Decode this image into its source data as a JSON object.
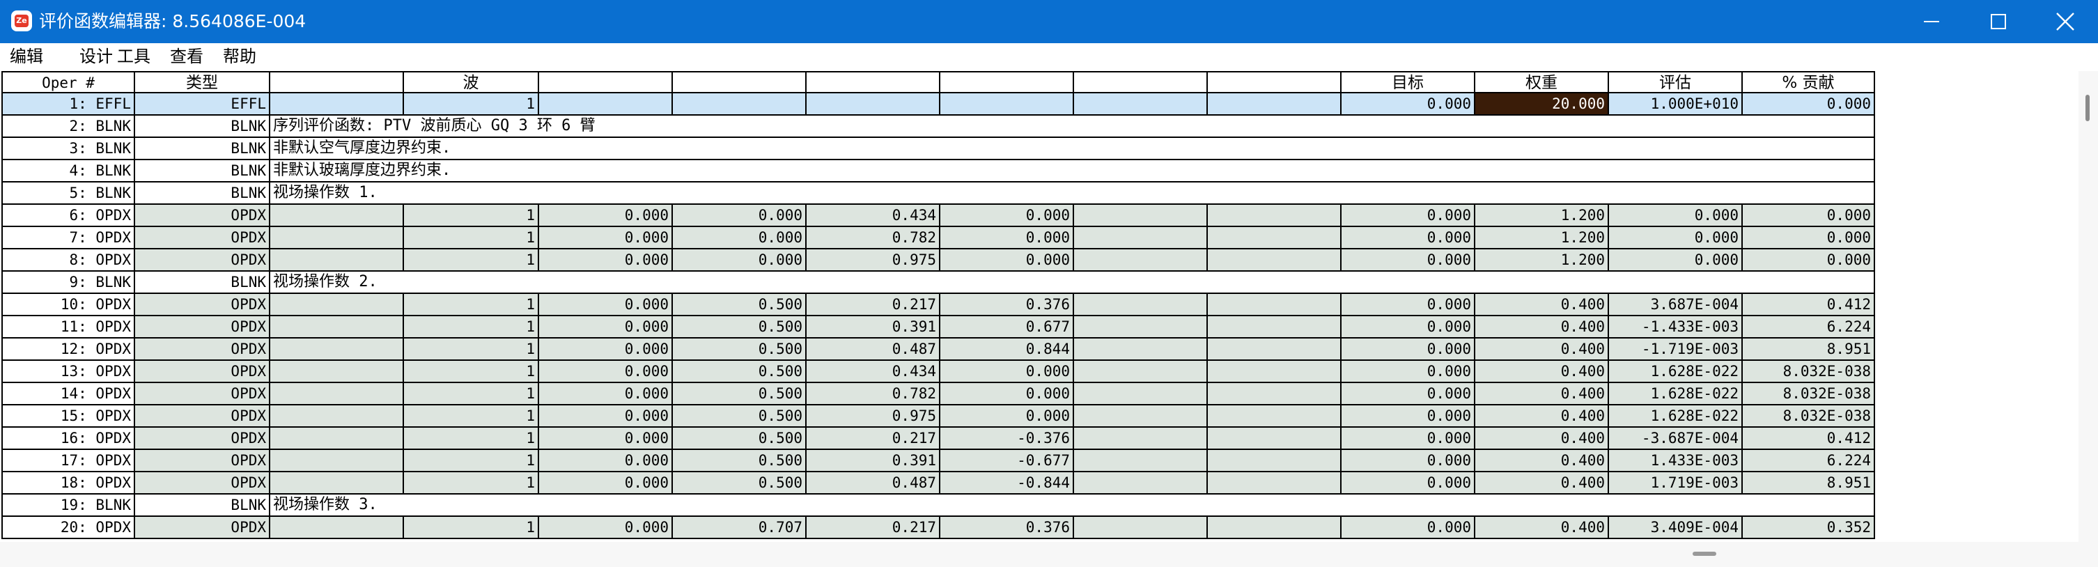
{
  "window": {
    "title": "评价函数编辑器: 8.564086E-004",
    "app_icon_label": "Ze",
    "colors": {
      "titlebar": "#0a6fd0",
      "selected_row": "#cce4f7",
      "operand_row": "#dde5df",
      "weight_highlight": "#3a1c08"
    }
  },
  "menu": [
    {
      "label": "编辑"
    },
    {
      "label": "设计"
    },
    {
      "label": "工具"
    },
    {
      "label": "查看"
    },
    {
      "label": "帮助"
    }
  ],
  "table": {
    "headers": [
      "Oper #",
      "类型",
      "",
      "波",
      "",
      "",
      "",
      "",
      "",
      "",
      "目标",
      "权重",
      "评估",
      "% 贡献"
    ],
    "rows": [
      {
        "kind": "op",
        "selected": true,
        "cells": [
          "1: EFFL",
          "EFFL",
          "",
          "1",
          "",
          "",
          "",
          "",
          "",
          "",
          "0.000",
          "20.000",
          "1.000E+010",
          "0.000"
        ]
      },
      {
        "kind": "blnk",
        "cells": [
          "2: BLNK",
          "BLNK"
        ],
        "comment": "序列评价函数: PTV 波前质心 GQ 3 环 6 臂"
      },
      {
        "kind": "blnk",
        "cells": [
          "3: BLNK",
          "BLNK"
        ],
        "comment": "非默认空气厚度边界约束."
      },
      {
        "kind": "blnk",
        "cells": [
          "4: BLNK",
          "BLNK"
        ],
        "comment": "非默认玻璃厚度边界约束."
      },
      {
        "kind": "blnk",
        "cells": [
          "5: BLNK",
          "BLNK"
        ],
        "comment": "视场操作数 1."
      },
      {
        "kind": "op",
        "cells": [
          "6: OPDX",
          "OPDX",
          "",
          "1",
          "0.000",
          "0.000",
          "0.434",
          "0.000",
          "",
          "",
          "0.000",
          "1.200",
          "0.000",
          "0.000"
        ]
      },
      {
        "kind": "op",
        "cells": [
          "7: OPDX",
          "OPDX",
          "",
          "1",
          "0.000",
          "0.000",
          "0.782",
          "0.000",
          "",
          "",
          "0.000",
          "1.200",
          "0.000",
          "0.000"
        ]
      },
      {
        "kind": "op",
        "cells": [
          "8: OPDX",
          "OPDX",
          "",
          "1",
          "0.000",
          "0.000",
          "0.975",
          "0.000",
          "",
          "",
          "0.000",
          "1.200",
          "0.000",
          "0.000"
        ]
      },
      {
        "kind": "blnk",
        "cells": [
          "9: BLNK",
          "BLNK"
        ],
        "comment": "视场操作数 2."
      },
      {
        "kind": "op",
        "cells": [
          "10: OPDX",
          "OPDX",
          "",
          "1",
          "0.000",
          "0.500",
          "0.217",
          "0.376",
          "",
          "",
          "0.000",
          "0.400",
          "3.687E-004",
          "0.412"
        ]
      },
      {
        "kind": "op",
        "cells": [
          "11: OPDX",
          "OPDX",
          "",
          "1",
          "0.000",
          "0.500",
          "0.391",
          "0.677",
          "",
          "",
          "0.000",
          "0.400",
          "-1.433E-003",
          "6.224"
        ]
      },
      {
        "kind": "op",
        "cells": [
          "12: OPDX",
          "OPDX",
          "",
          "1",
          "0.000",
          "0.500",
          "0.487",
          "0.844",
          "",
          "",
          "0.000",
          "0.400",
          "-1.719E-003",
          "8.951"
        ]
      },
      {
        "kind": "op",
        "cells": [
          "13: OPDX",
          "OPDX",
          "",
          "1",
          "0.000",
          "0.500",
          "0.434",
          "0.000",
          "",
          "",
          "0.000",
          "0.400",
          "1.628E-022",
          "8.032E-038"
        ]
      },
      {
        "kind": "op",
        "cells": [
          "14: OPDX",
          "OPDX",
          "",
          "1",
          "0.000",
          "0.500",
          "0.782",
          "0.000",
          "",
          "",
          "0.000",
          "0.400",
          "1.628E-022",
          "8.032E-038"
        ]
      },
      {
        "kind": "op",
        "cells": [
          "15: OPDX",
          "OPDX",
          "",
          "1",
          "0.000",
          "0.500",
          "0.975",
          "0.000",
          "",
          "",
          "0.000",
          "0.400",
          "1.628E-022",
          "8.032E-038"
        ]
      },
      {
        "kind": "op",
        "cells": [
          "16: OPDX",
          "OPDX",
          "",
          "1",
          "0.000",
          "0.500",
          "0.217",
          "-0.376",
          "",
          "",
          "0.000",
          "0.400",
          "-3.687E-004",
          "0.412"
        ]
      },
      {
        "kind": "op",
        "cells": [
          "17: OPDX",
          "OPDX",
          "",
          "1",
          "0.000",
          "0.500",
          "0.391",
          "-0.677",
          "",
          "",
          "0.000",
          "0.400",
          "1.433E-003",
          "6.224"
        ]
      },
      {
        "kind": "op",
        "cells": [
          "18: OPDX",
          "OPDX",
          "",
          "1",
          "0.000",
          "0.500",
          "0.487",
          "-0.844",
          "",
          "",
          "0.000",
          "0.400",
          "1.719E-003",
          "8.951"
        ]
      },
      {
        "kind": "blnk",
        "cells": [
          "19: BLNK",
          "BLNK"
        ],
        "comment": "视场操作数 3."
      },
      {
        "kind": "op",
        "cells": [
          "20: OPDX",
          "OPDX",
          "",
          "1",
          "0.000",
          "0.707",
          "0.217",
          "0.376",
          "",
          "",
          "0.000",
          "0.400",
          "3.409E-004",
          "0.352"
        ]
      }
    ]
  }
}
